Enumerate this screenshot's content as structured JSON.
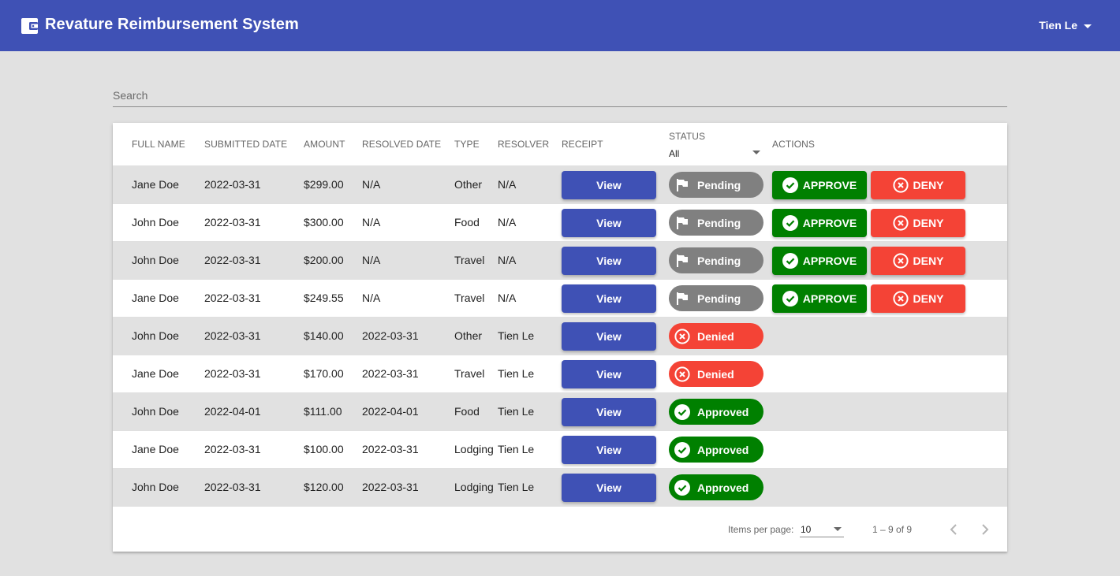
{
  "app": {
    "title": "Revature Reimbursement System",
    "logo_icon": "wallet-icon",
    "user_name": "Tien Le",
    "primary_color": "#3f51b5"
  },
  "search": {
    "placeholder": "Search",
    "value": ""
  },
  "table": {
    "headers": {
      "full_name": "FULL NAME",
      "submitted_date": "SUBMITTED DATE",
      "amount": "AMOUNT",
      "resolved_date": "RESOLVED DATE",
      "type": "TYPE",
      "resolver": "RESOLVER",
      "receipt": "RECEIPT",
      "status": "STATUS",
      "actions": "ACTIONS"
    },
    "status_filter": "All",
    "view_label": "View",
    "approve_label": "APPROVE",
    "deny_label": "DENY",
    "rows": [
      {
        "full_name": "Jane Doe",
        "submitted_date": "2022-03-31",
        "amount": "$299.00",
        "resolved_date": "N/A",
        "type": "Other",
        "resolver": "N/A",
        "status": "Pending"
      },
      {
        "full_name": "John Doe",
        "submitted_date": "2022-03-31",
        "amount": "$300.00",
        "resolved_date": "N/A",
        "type": "Food",
        "resolver": "N/A",
        "status": "Pending"
      },
      {
        "full_name": "John Doe",
        "submitted_date": "2022-03-31",
        "amount": "$200.00",
        "resolved_date": "N/A",
        "type": "Travel",
        "resolver": "N/A",
        "status": "Pending"
      },
      {
        "full_name": "Jane Doe",
        "submitted_date": "2022-03-31",
        "amount": "$249.55",
        "resolved_date": "N/A",
        "type": "Travel",
        "resolver": "N/A",
        "status": "Pending"
      },
      {
        "full_name": "John Doe",
        "submitted_date": "2022-03-31",
        "amount": "$140.00",
        "resolved_date": "2022-03-31",
        "type": "Other",
        "resolver": "Tien Le",
        "status": "Denied"
      },
      {
        "full_name": "Jane Doe",
        "submitted_date": "2022-03-31",
        "amount": "$170.00",
        "resolved_date": "2022-03-31",
        "type": "Travel",
        "resolver": "Tien Le",
        "status": "Denied"
      },
      {
        "full_name": "John Doe",
        "submitted_date": "2022-04-01",
        "amount": "$111.00",
        "resolved_date": "2022-04-01",
        "type": "Food",
        "resolver": "Tien Le",
        "status": "Approved"
      },
      {
        "full_name": "Jane Doe",
        "submitted_date": "2022-03-31",
        "amount": "$100.00",
        "resolved_date": "2022-03-31",
        "type": "Lodging",
        "resolver": "Tien Le",
        "status": "Approved"
      },
      {
        "full_name": "John Doe",
        "submitted_date": "2022-03-31",
        "amount": "$120.00",
        "resolved_date": "2022-03-31",
        "type": "Lodging",
        "resolver": "Tien Le",
        "status": "Approved"
      }
    ]
  },
  "status_colors": {
    "Pending": "#808080",
    "Denied": "#f44336",
    "Approved": "#008000"
  },
  "paginator": {
    "items_per_page_label": "Items per page:",
    "items_per_page": "10",
    "range_label": "1 – 9 of 9"
  }
}
